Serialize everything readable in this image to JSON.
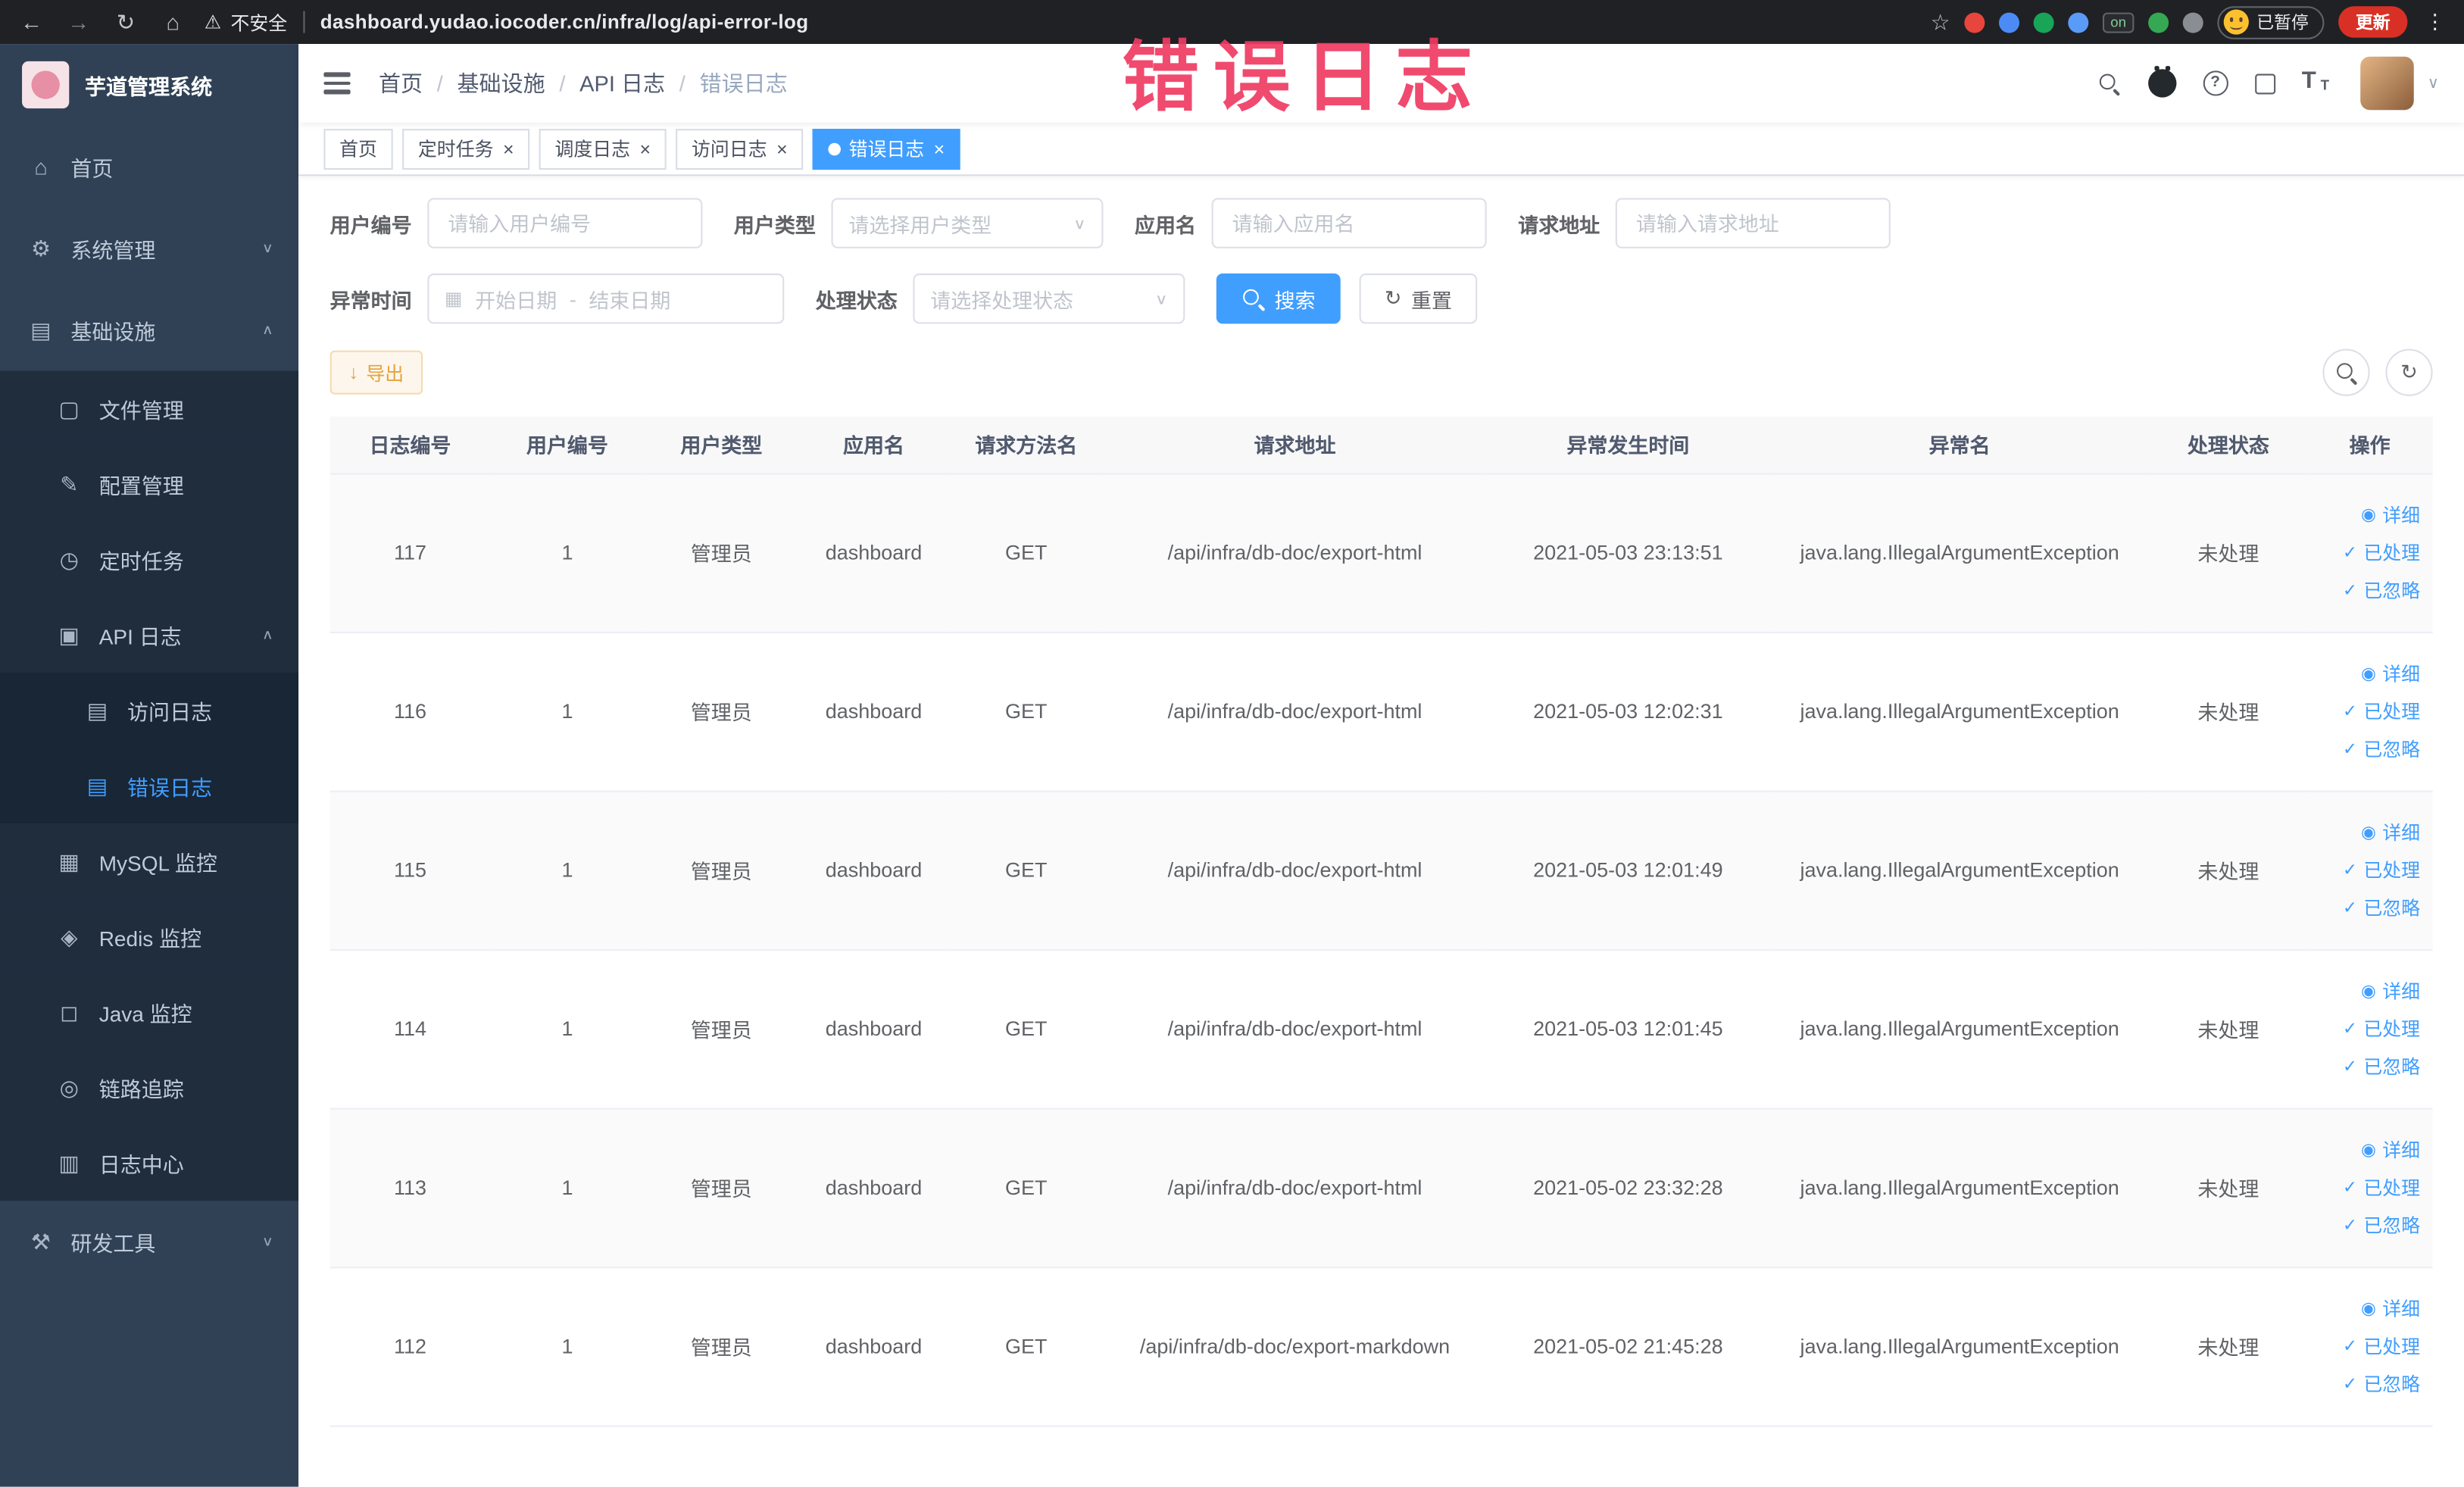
{
  "colors": {
    "accent": "#409eff",
    "watermark": "#ef3b63",
    "warning": "#e6a23c"
  },
  "watermark": "错误日志",
  "browser": {
    "security_label": "不安全",
    "url": "dashboard.yudao.iocoder.cn/infra/log/api-error-log",
    "paused_badge": "已暂停",
    "update_label": "更新",
    "extensions": [
      {
        "color": "#e8453c"
      },
      {
        "color": "#4c8bf5"
      },
      {
        "color": "#18a558"
      },
      {
        "color": "#5b9bf8"
      },
      {
        "label": "on"
      },
      {
        "color": "#34a853"
      },
      {
        "color": "#8a8d91"
      }
    ]
  },
  "sidebar": {
    "title": "芋道管理系统",
    "items": [
      {
        "label": "首页",
        "icon": "home",
        "cls": "lv0"
      },
      {
        "label": "系统管理",
        "icon": "gear",
        "cls": "lv0",
        "chevron": "chevron-down"
      },
      {
        "label": "基础设施",
        "icon": "platform",
        "cls": "lv0",
        "chevron": "chevron-up"
      },
      {
        "label": "文件管理",
        "icon": "file",
        "cls": "lv1"
      },
      {
        "label": "配置管理",
        "icon": "edit",
        "cls": "lv1"
      },
      {
        "label": "定时任务",
        "icon": "timer",
        "cls": "lv1"
      },
      {
        "label": "API 日志",
        "icon": "log",
        "cls": "lv1",
        "chevron": "chevron-up"
      },
      {
        "label": "访问日志",
        "icon": "doc",
        "cls": "lv2"
      },
      {
        "label": "错误日志",
        "icon": "doc",
        "cls": "lv2 active"
      },
      {
        "label": "MySQL 监控",
        "icon": "mysql",
        "cls": "lv1"
      },
      {
        "label": "Redis 监控",
        "icon": "redis",
        "cls": "lv1"
      },
      {
        "label": "Java 监控",
        "icon": "java",
        "cls": "lv1"
      },
      {
        "label": "链路追踪",
        "icon": "trace",
        "cls": "lv1"
      },
      {
        "label": "日志中心",
        "icon": "log-center",
        "cls": "lv1"
      },
      {
        "label": "研发工具",
        "icon": "tools",
        "cls": "lv0",
        "chevron": "chevron-down"
      }
    ]
  },
  "breadcrumb": [
    {
      "label": "首页"
    },
    {
      "label": "基础设施",
      "sep": "/"
    },
    {
      "label": "API 日志",
      "sep": "/"
    },
    {
      "label": "错误日志",
      "sep": "/",
      "cls": "last"
    }
  ],
  "navbar": {
    "icons": [
      "search-icon",
      "github-icon",
      "help-icon",
      "fullscreen-icon",
      "font-size-icon"
    ]
  },
  "tabs": [
    {
      "label": "首页"
    },
    {
      "label": "定时任务",
      "closable": true
    },
    {
      "label": "调度日志",
      "closable": true
    },
    {
      "label": "访问日志",
      "closable": true
    },
    {
      "label": "错误日志",
      "closable": true,
      "active": true,
      "cls": "active"
    }
  ],
  "filters": {
    "user_id": {
      "label": "用户编号",
      "placeholder": "请输入用户编号"
    },
    "user_type": {
      "label": "用户类型",
      "placeholder": "请选择用户类型"
    },
    "app_name": {
      "label": "应用名",
      "placeholder": "请输入应用名"
    },
    "request_url": {
      "label": "请求地址",
      "placeholder": "请输入请求地址"
    },
    "exception_time": {
      "label": "异常时间",
      "start_placeholder": "开始日期",
      "separator": "-",
      "end_placeholder": "结束日期"
    },
    "process_status": {
      "label": "处理状态",
      "placeholder": "请选择处理状态"
    },
    "search_label": "搜索",
    "reset_label": "重置"
  },
  "toolbar": {
    "export_label": "导出"
  },
  "table": {
    "columns": [
      "日志编号",
      "用户编号",
      "用户类型",
      "应用名",
      "请求方法名",
      "请求地址",
      "异常发生时间",
      "异常名",
      "处理状态",
      "操作"
    ],
    "rows": [
      {
        "log_id": "117",
        "user_id": "1",
        "user_type": "管理员",
        "app_name": "dashboard",
        "method": "GET",
        "url": "/api/infra/db-doc/export-html",
        "time": "2021-05-03 23:13:51",
        "exception": "java.lang.IllegalArgumentException",
        "status": "未处理"
      },
      {
        "log_id": "116",
        "user_id": "1",
        "user_type": "管理员",
        "app_name": "dashboard",
        "method": "GET",
        "url": "/api/infra/db-doc/export-html",
        "time": "2021-05-03 12:02:31",
        "exception": "java.lang.IllegalArgumentException",
        "status": "未处理"
      },
      {
        "log_id": "115",
        "user_id": "1",
        "user_type": "管理员",
        "app_name": "dashboard",
        "method": "GET",
        "url": "/api/infra/db-doc/export-html",
        "time": "2021-05-03 12:01:49",
        "exception": "java.lang.IllegalArgumentException",
        "status": "未处理"
      },
      {
        "log_id": "114",
        "user_id": "1",
        "user_type": "管理员",
        "app_name": "dashboard",
        "method": "GET",
        "url": "/api/infra/db-doc/export-html",
        "time": "2021-05-03 12:01:45",
        "exception": "java.lang.IllegalArgumentException",
        "status": "未处理"
      },
      {
        "log_id": "113",
        "user_id": "1",
        "user_type": "管理员",
        "app_name": "dashboard",
        "method": "GET",
        "url": "/api/infra/db-doc/export-html",
        "time": "2021-05-02 23:32:28",
        "exception": "java.lang.IllegalArgumentException",
        "status": "未处理"
      },
      {
        "log_id": "112",
        "user_id": "1",
        "user_type": "管理员",
        "app_name": "dashboard",
        "method": "GET",
        "url": "/api/infra/db-doc/export-markdown",
        "time": "2021-05-02 21:45:28",
        "exception": "java.lang.IllegalArgumentException",
        "status": "未处理"
      }
    ],
    "actions": [
      {
        "icon": "eye",
        "label": "详细"
      },
      {
        "icon": "check",
        "label": "已处理"
      },
      {
        "icon": "check",
        "label": "已忽略"
      }
    ]
  },
  "icon_glyphs": {
    "arrow-left": "←",
    "arrow-right": "→",
    "reload": "↻",
    "home-outline": "⌂",
    "warning": "⚠",
    "star": "☆",
    "kebab": "⋮",
    "home": "⌂",
    "gear": "⚙",
    "platform": "▤",
    "file": "▢",
    "edit": "✎",
    "timer": "◷",
    "log": "▣",
    "doc": "▤",
    "mysql": "▦",
    "redis": "◈",
    "java": "◻",
    "trace": "◎",
    "log-center": "▥",
    "tools": "⚒",
    "chevron-down": "∨",
    "chevron-up": "∧",
    "caret-down": "∨",
    "eye": "◉",
    "check": "✓",
    "refresh": "↻",
    "download": "↓",
    "close": "×",
    "calendar": "▦"
  }
}
